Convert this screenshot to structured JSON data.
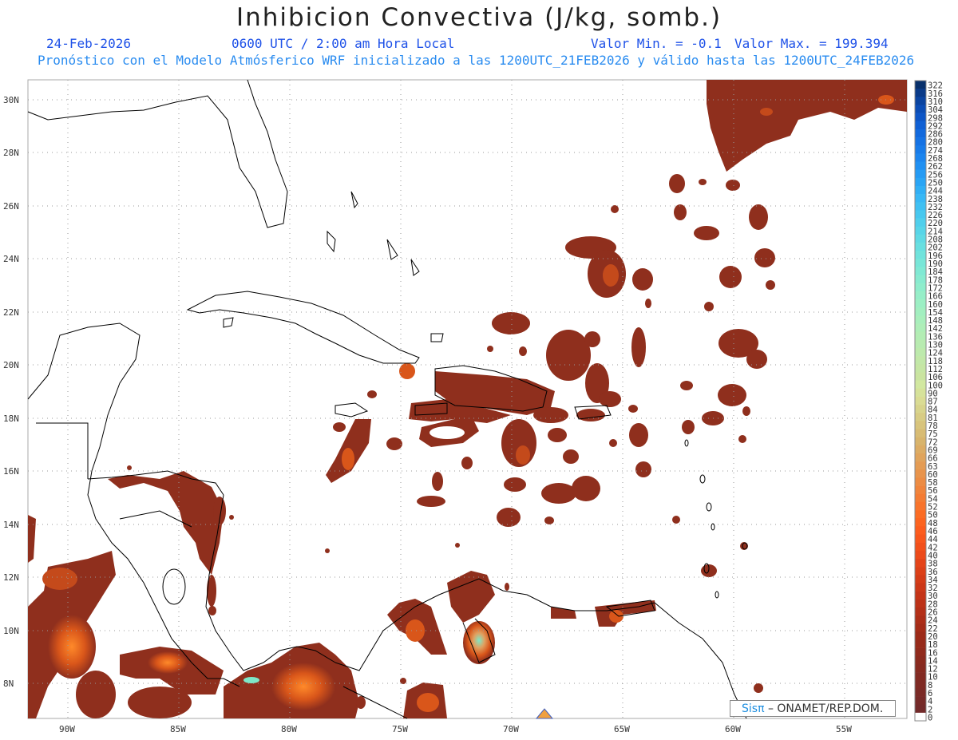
{
  "title": "Inhibicion Convectiva (J/kg, somb.)",
  "header": {
    "date": "24-Feb-2026",
    "time": "0600 UTC / 2:00 am Hora Local",
    "min": "Valor Min. = -0.1",
    "max": "Valor Max. = 199.394",
    "model": "Pronóstico con el Modelo Atmósferico WRF inicializado a las 1200UTC_21FEB2026 y válido hasta las  1200UTC_24FEB2026"
  },
  "axes": {
    "lat_labels": [
      "30N",
      "28N",
      "26N",
      "24N",
      "22N",
      "20N",
      "18N",
      "16N",
      "14N",
      "12N",
      "10N",
      "8N"
    ],
    "lon_labels": [
      "90W",
      "85W",
      "80W",
      "75W",
      "70W",
      "65W",
      "60W",
      "55W"
    ]
  },
  "colorbar": {
    "labels": [
      "322",
      "316",
      "310",
      "304",
      "298",
      "292",
      "286",
      "280",
      "274",
      "268",
      "262",
      "256",
      "250",
      "244",
      "238",
      "232",
      "226",
      "220",
      "214",
      "208",
      "202",
      "196",
      "190",
      "184",
      "178",
      "172",
      "166",
      "160",
      "154",
      "148",
      "142",
      "136",
      "130",
      "124",
      "118",
      "112",
      "106",
      "100",
      "90",
      "87",
      "84",
      "81",
      "78",
      "75",
      "72",
      "69",
      "66",
      "63",
      "60",
      "58",
      "56",
      "54",
      "52",
      "50",
      "48",
      "46",
      "44",
      "42",
      "40",
      "38",
      "36",
      "34",
      "32",
      "30",
      "28",
      "26",
      "24",
      "22",
      "20",
      "18",
      "16",
      "14",
      "12",
      "10",
      "8",
      "6",
      "4",
      "2",
      "0"
    ],
    "colors": [
      "#08306b",
      "#0a3a88",
      "#0b44a0",
      "#0c4db5",
      "#0e56c6",
      "#1060d4",
      "#1269dd",
      "#1572e4",
      "#187be9",
      "#1c85ee",
      "#2090f2",
      "#259bf4",
      "#2aa5f5",
      "#31aff5",
      "#39b8f5",
      "#40c0f2",
      "#48c8ef",
      "#50cfec",
      "#58d5e8",
      "#60dae4",
      "#68dfe0",
      "#70e3dc",
      "#78e6d8",
      "#80e9d4",
      "#88ebd0",
      "#8fedcc",
      "#96eec8",
      "#9cefc4",
      "#a2efc0",
      "#a8efbc",
      "#aeeeb8",
      "#b3edb4",
      "#b8ebb0",
      "#bdeaac",
      "#c2e8a8",
      "#c6e6a4",
      "#cae4a0",
      "#d2e8a0",
      "#d6e29a",
      "#dadc94",
      "#d8d48c",
      "#d8cc84",
      "#d8c47c",
      "#d8bc74",
      "#d8b46c",
      "#dcac64",
      "#e0a45c",
      "#e49c54",
      "#e8944c",
      "#ec8c44",
      "#f0843c",
      "#f47c34",
      "#f8742c",
      "#fb6c24",
      "#fc6420",
      "#fc5c1e",
      "#f8561c",
      "#f2501b",
      "#ec4a1a",
      "#e44419",
      "#dc4018",
      "#d43c18",
      "#cc3818",
      "#c43418",
      "#bc3218",
      "#b43018",
      "#ac2e18",
      "#a42c18",
      "#9c2a18",
      "#962a1a",
      "#902a1c",
      "#8a2a1e",
      "#862a20",
      "#822a22",
      "#7e2a24",
      "#7a2a26",
      "#762a28",
      "#722a2a",
      "#ffffff"
    ]
  },
  "credit": {
    "sis": "Sisπ",
    "org": " – ONAMET/REP.DOM."
  },
  "colors": {
    "cin_low": "#8f2f1d",
    "cin_mid": "#d9561a",
    "cin_high": "#ff8a2a",
    "cin_peak": "#7ee8c8",
    "header_blue": "#1f52e8",
    "header_cyan": "#2a8cf0"
  }
}
